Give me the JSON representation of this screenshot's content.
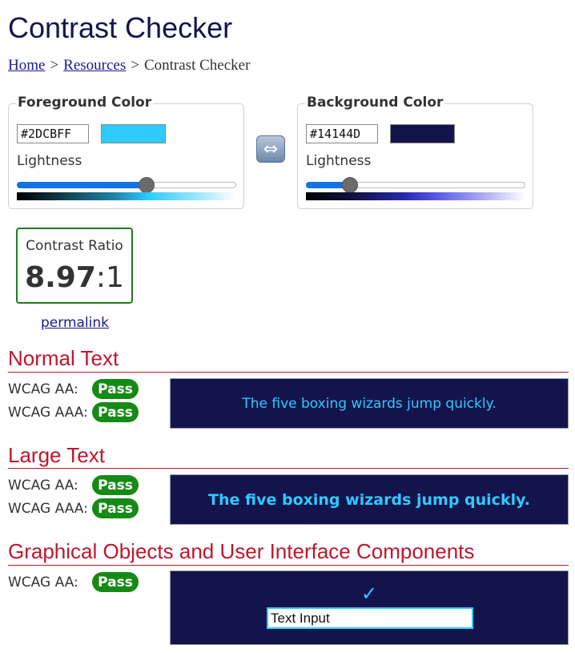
{
  "page": {
    "title": "Contrast Checker"
  },
  "breadcrumb": {
    "home": "Home",
    "resources": "Resources",
    "current": "Contrast Checker",
    "separator": ">"
  },
  "foreground": {
    "legend": "Foreground Color",
    "hex": "#2DCBFF",
    "color": "#2DCBFF",
    "lightness_label": "Lightness",
    "lightness": 0.59
  },
  "background": {
    "legend": "Background Color",
    "hex": "#14144D",
    "color": "#14144D",
    "lightness_label": "Lightness",
    "lightness": 0.2
  },
  "swap": {
    "icon": "swap-arrows-icon"
  },
  "contrast": {
    "label": "Contrast Ratio",
    "ratio": "8.97",
    "suffix": ":1",
    "permalink": "permalink"
  },
  "sections": {
    "normal": {
      "title": "Normal Text",
      "aa_label": "WCAG AA:",
      "aa_result": "Pass",
      "aaa_label": "WCAG AAA:",
      "aaa_result": "Pass",
      "sample": "The five boxing wizards jump quickly."
    },
    "large": {
      "title": "Large Text",
      "aa_label": "WCAG AA:",
      "aa_result": "Pass",
      "aaa_label": "WCAG AAA:",
      "aaa_result": "Pass",
      "sample": "The five boxing wizards jump quickly."
    },
    "graphics": {
      "title": "Graphical Objects and User Interface Components",
      "aa_label": "WCAG AA:",
      "aa_result": "Pass",
      "check_icon": "checkmark-icon",
      "input_sample": "Text Input"
    }
  },
  "colors": {
    "title": "#14144D",
    "section_red": "#c0162d",
    "pass_green": "#168a16",
    "link": "#1a1a8e"
  }
}
